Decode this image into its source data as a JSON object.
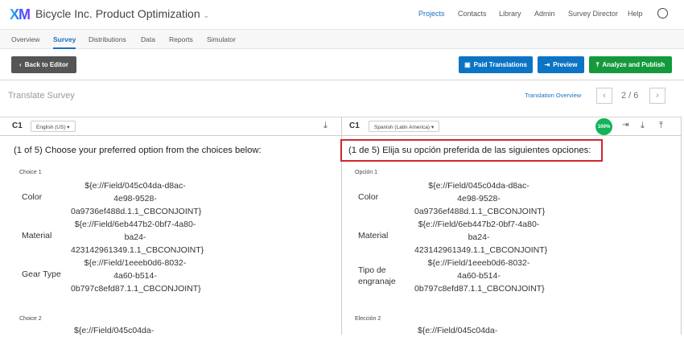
{
  "app": {
    "logo": "XM",
    "project_title": "Bicycle Inc. Product Optimization"
  },
  "nav": [
    {
      "label": "Projects"
    },
    {
      "label": "Contacts"
    },
    {
      "label": "Library"
    },
    {
      "label": "Admin"
    },
    {
      "label": "Survey Director"
    },
    {
      "label": "Help"
    }
  ],
  "tabs": [
    {
      "label": "Overview"
    },
    {
      "label": "Survey"
    },
    {
      "label": "Distributions"
    },
    {
      "label": "Data"
    },
    {
      "label": "Reports"
    },
    {
      "label": "Simulator"
    }
  ],
  "toolbar": {
    "back": "Back to Editor",
    "paid": "Paid Translations",
    "preview": "Preview",
    "publish": "Analyze and Publish"
  },
  "translate": {
    "title": "Translate Survey",
    "overview_link": "Translation Overview",
    "page": "2 / 6"
  },
  "left": {
    "qid": "C1",
    "language": "English (US)",
    "question": "(1 of 5) Choose your preferred option from the choices below:",
    "choice1": "Choice 1",
    "choice2": "Choice 2",
    "rows": [
      {
        "label": "Color",
        "value": [
          "${e://Field/045c04da-d8ac-",
          "4e98-9528-",
          "0a9736ef488d.1.1_CBCONJOINT}"
        ]
      },
      {
        "label": "Material",
        "value": [
          "${e://Field/6eb447b2-0bf7-4a80-",
          "ba24-",
          "423142961349.1.1_CBCONJOINT}"
        ]
      },
      {
        "label": "Gear Type",
        "value": [
          "${e://Field/1eeeb0d6-8032-",
          "4a60-b514-",
          "0b797c8efd87.1.1_CBCONJOINT}"
        ]
      }
    ],
    "next_value": "${e://Field/045c04da-"
  },
  "right": {
    "qid": "C1",
    "language": "Spanish (Latin America)",
    "progress": "100%",
    "question": "(1 de 5) Elija su opción preferida de las siguientes opciones:",
    "choice1": "Opción 1",
    "choice2": "Elección 2",
    "rows": [
      {
        "label": "Color",
        "value": [
          "${e://Field/045c04da-d8ac-",
          "4e98-9528-",
          "0a9736ef488d.1.1_CBCONJOINT}"
        ]
      },
      {
        "label": "Material",
        "value": [
          "${e://Field/6eb447b2-0bf7-4a80-",
          "ba24-",
          "423142961349.1.1_CBCONJOINT}"
        ]
      },
      {
        "label": "Tipo de engranaje",
        "value": [
          "${e://Field/1eeeb0d6-8032-",
          "4a60-b514-",
          "0b797c8efd87.1.1_CBCONJOINT}"
        ]
      }
    ],
    "next_value": "${e://Field/045c04da-"
  },
  "colors": {
    "blue": "#0b74c4",
    "green": "#14993d",
    "highlight": "#d0262c"
  }
}
